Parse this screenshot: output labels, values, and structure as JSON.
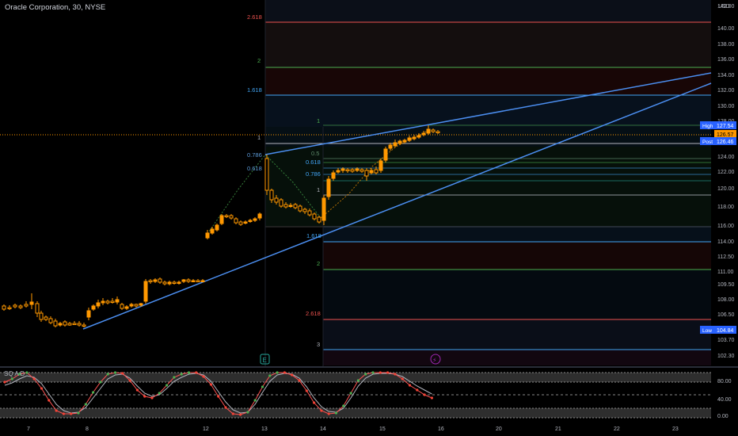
{
  "header": {
    "title": "Oracle Corporation, 30, NYSE",
    "currency": "USD"
  },
  "price_axis": {
    "ticks": [
      "142.00",
      "140.00",
      "138.00",
      "136.00",
      "134.00",
      "132.00",
      "130.00",
      "128.00",
      "124.00",
      "122.00",
      "120.00",
      "118.00",
      "116.00",
      "114.00",
      "112.50",
      "111.00",
      "109.50",
      "108.00",
      "106.50",
      "103.70",
      "102.30"
    ],
    "markers": [
      {
        "label": "High",
        "value": "127.54",
        "color": "#2962ff",
        "text_color": "#ffffff"
      },
      {
        "label": "",
        "value": "126.57",
        "color": "#ff9800",
        "text_color": "#000000"
      },
      {
        "label": "Post",
        "value": "126.46",
        "color": "#2962ff",
        "text_color": "#ffffff"
      },
      {
        "label": "Low",
        "value": "104.84",
        "color": "#2962ff",
        "text_color": "#ffffff"
      }
    ]
  },
  "time_axis": {
    "labels": [
      "7",
      "8",
      "12",
      "13",
      "14",
      "15",
      "16",
      "20",
      "21",
      "22",
      "23"
    ]
  },
  "fib_left": {
    "labels": [
      "2.618",
      "2",
      "1.618",
      "1",
      "0.786",
      "0.618"
    ]
  },
  "fib_right": {
    "labels": [
      "1",
      "0.5",
      "0.618",
      "0.786",
      "1",
      "1.618",
      "2",
      "2.618",
      "3"
    ]
  },
  "event_icons": [
    {
      "name": "earnings-icon",
      "glyph": "E",
      "color": "#26a69a"
    },
    {
      "name": "flash-icon",
      "glyph": "⚡",
      "color": "#9c27b0"
    }
  ],
  "oscillator": {
    "title": "SQ A D",
    "ticks": [
      "80.00",
      "40.00",
      "0.00"
    ]
  },
  "colors": {
    "candle": "#ff9800",
    "trendline": "#4b8ef0",
    "k_line": "#ff5252",
    "d_line": "#b2b5be",
    "dot_up": "#4caf50",
    "dot_down": "#f44336"
  }
}
